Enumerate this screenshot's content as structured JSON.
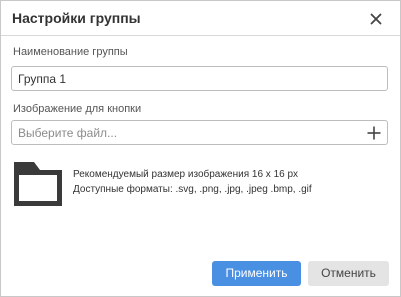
{
  "dialog": {
    "title": "Настройки группы"
  },
  "group_name": {
    "label": "Наименование группы",
    "value": "Группа 1"
  },
  "button_image": {
    "label": "Изображение для кнопки",
    "placeholder": "Выберите файл..."
  },
  "hints": {
    "size": "Рекомендуемый размер изображения 16 x 16 px",
    "formats": "Доступные форматы: .svg, .png, .jpg, .jpeg .bmp, .gif"
  },
  "actions": {
    "apply_label": "Применить",
    "cancel_label": "Отменить"
  },
  "icons": {
    "close": "close-icon",
    "add": "plus-icon",
    "preview": "folder-icon"
  },
  "colors": {
    "primary": "#4a90e2",
    "secondary": "#e4e4e4",
    "folder": "#3a3a3a"
  }
}
